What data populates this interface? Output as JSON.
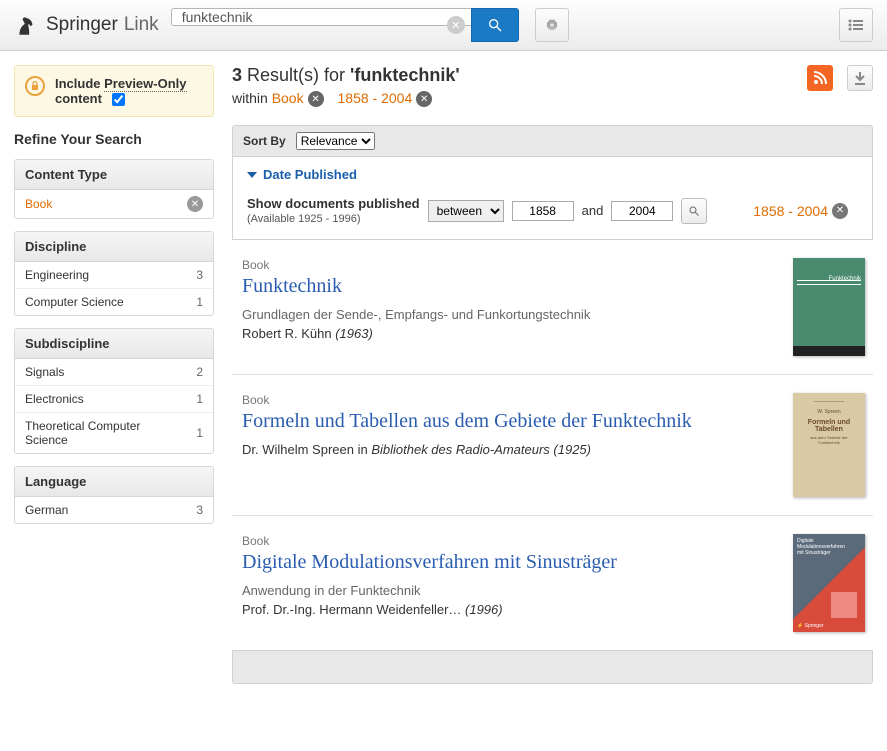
{
  "brand": {
    "name1": "Springer",
    "name2": "Link"
  },
  "search": {
    "query": "funktechnik"
  },
  "preview": {
    "prefix": "Include ",
    "linked": "Preview-Only",
    "suffix": " content"
  },
  "refine_title": "Refine Your Search",
  "facets": {
    "content_type": {
      "title": "Content Type",
      "active": "Book"
    },
    "discipline": {
      "title": "Discipline",
      "items": [
        {
          "label": "Engineering",
          "count": "3"
        },
        {
          "label": "Computer Science",
          "count": "1"
        }
      ]
    },
    "subdiscipline": {
      "title": "Subdiscipline",
      "items": [
        {
          "label": "Signals",
          "count": "2"
        },
        {
          "label": "Electronics",
          "count": "1"
        },
        {
          "label": "Theoretical Computer Science",
          "count": "1"
        }
      ]
    },
    "language": {
      "title": "Language",
      "items": [
        {
          "label": "German",
          "count": "3"
        }
      ]
    }
  },
  "results_header": {
    "count": "3",
    "text": " Result(s) for ",
    "term": "'funktechnik'",
    "within_label": "within ",
    "within_value": "Book",
    "date_range": "1858 - 2004"
  },
  "sort": {
    "label": "Sort By",
    "selected": "Relevance"
  },
  "date_panel": {
    "toggle": "Date Published",
    "show_label": "Show documents published",
    "available": "(Available 1925 - 1996)",
    "mode": "between",
    "start": "1858",
    "and": "and",
    "end": "2004",
    "current": "1858 - 2004"
  },
  "results": [
    {
      "kind": "Book",
      "title": "Funktechnik",
      "subtitle": "Grundlagen der Sende-, Empfangs- und Funkortungstechnik",
      "authors": "Robert R. Kühn ",
      "extra": "(1963)"
    },
    {
      "kind": "Book",
      "title": "Formeln und Tabellen aus dem Gebiete der Funktechnik",
      "subtitle": "",
      "authors": "Dr. Wilhelm Spreen in ",
      "extra": "Bibliothek des Radio-Amateurs (1925)"
    },
    {
      "kind": "Book",
      "title": "Digitale Modulationsverfahren mit Sinusträger",
      "subtitle": "Anwendung in der Funktechnik",
      "authors": "Prof. Dr.-Ing. Hermann Weidenfeller… ",
      "extra": "(1996)"
    }
  ]
}
